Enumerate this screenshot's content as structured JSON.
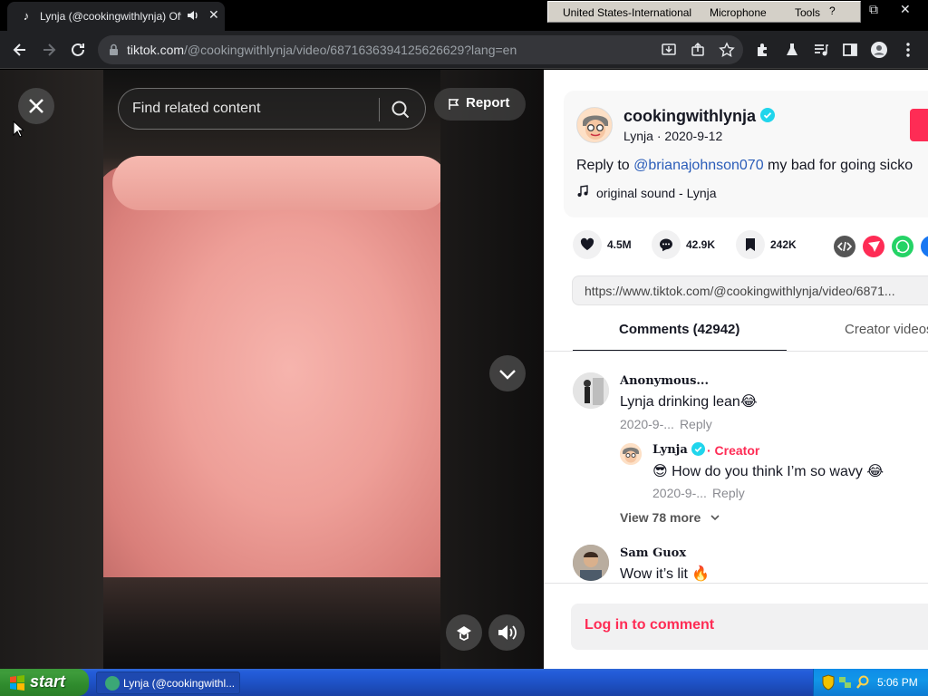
{
  "browser": {
    "tab_title": "Lynja (@cookingwithlynja) Offi",
    "url_host": "tiktok.com",
    "url_path": "/@cookingwithlynja/video/6871636394125626629?lang=en"
  },
  "langbar": {
    "language": "United States-International",
    "microphone": "Microphone",
    "tools": "Tools"
  },
  "player": {
    "search_placeholder": "Find related content",
    "report_label": "Report"
  },
  "video_info": {
    "username": "cookingwithlynja",
    "nickname": "Lynja",
    "date": "2020-9-12",
    "description_prefix": "Reply to ",
    "mention": "@brianajohnson070",
    "description_rest": " my bad for going sicko",
    "music": "original sound - Lynja"
  },
  "stats": {
    "likes": "4.5M",
    "comments": "42.9K",
    "saves": "242K"
  },
  "copy_link": "https://www.tiktok.com/@cookingwithlynja/video/6871...",
  "tabs": {
    "comments": "Comments (42942)",
    "creator": "Creator videos"
  },
  "comments": [
    {
      "name": "Anonymous...",
      "text": "Lynja drinking lean😂",
      "date": "2020-9-...",
      "reply": "Reply"
    },
    {
      "name": "Lynja",
      "badge": "· Creator",
      "text": "😎 How do you think I’m so wavy 😂",
      "date": "2020-9-...",
      "reply": "Reply"
    },
    {
      "name": "Sam Guox",
      "text": "Wow it’s lit 🔥"
    }
  ],
  "view_more": "View 78 more",
  "login_prompt": "Log in to comment",
  "taskbar": {
    "start": "start",
    "task_title": "Lynja (@cookingwithl...",
    "clock": "5:06 PM"
  },
  "colors": {
    "accent": "#fe2c55",
    "mention": "#2b5db9",
    "verified": "#20d5ec"
  }
}
